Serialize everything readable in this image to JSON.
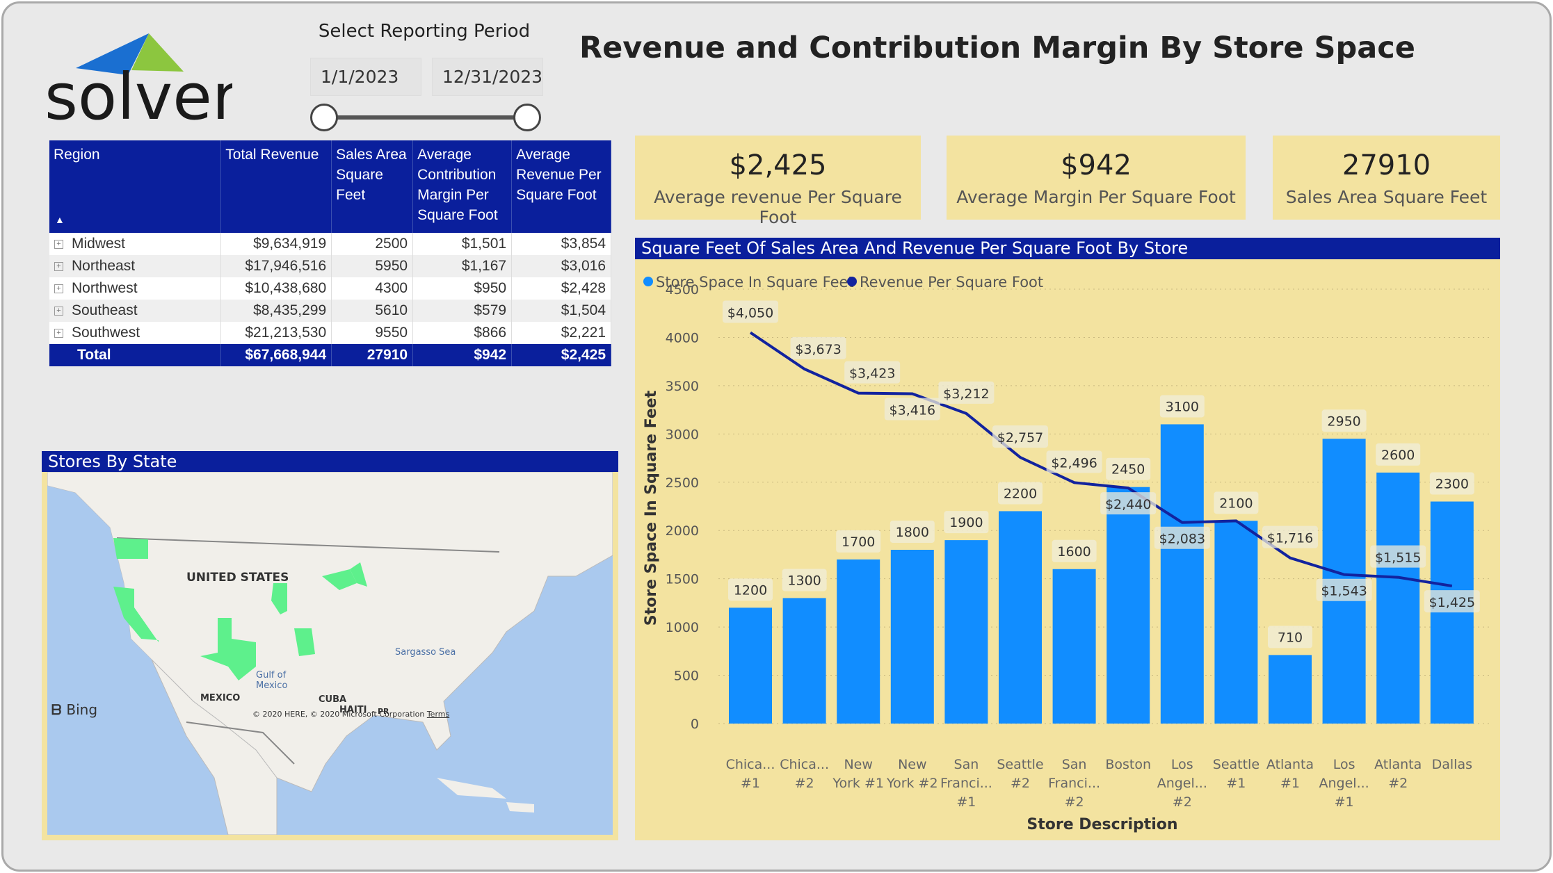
{
  "logo": {
    "text": "solver"
  },
  "title": "Revenue and Contribution Margin By Store Space",
  "period": {
    "label": "Select Reporting Period",
    "start": "1/1/2023",
    "end": "12/31/2023"
  },
  "table": {
    "headers": [
      "Region",
      "Total Revenue",
      "Sales Area Square Feet",
      "Average Contribution Margin Per Square Foot",
      "Average Revenue Per Square Foot"
    ],
    "rows": [
      [
        "Midwest",
        "$9,634,919",
        "2500",
        "$1,501",
        "$3,854"
      ],
      [
        "Northeast",
        "$17,946,516",
        "5950",
        "$1,167",
        "$3,016"
      ],
      [
        "Northwest",
        "$10,438,680",
        "4300",
        "$950",
        "$2,428"
      ],
      [
        "Southeast",
        "$8,435,299",
        "5610",
        "$579",
        "$1,504"
      ],
      [
        "Southwest",
        "$21,213,530",
        "9550",
        "$866",
        "$2,221"
      ]
    ],
    "total": [
      "Total",
      "$67,668,944",
      "27910",
      "$942",
      "$2,425"
    ]
  },
  "kpis": [
    {
      "value": "$2,425",
      "label": "Average revenue Per Square Foot"
    },
    {
      "value": "$942",
      "label": "Average Margin Per Square Foot"
    },
    {
      "value": "27910",
      "label": "Sales Area Square Feet"
    }
  ],
  "map": {
    "title": "Stores By State",
    "labels": {
      "us": "UNITED STATES",
      "mexico": "MEXICO",
      "gulf": "Gulf of Mexico",
      "sargasso": "Sargasso Sea",
      "cuba": "CUBA",
      "haiti": "HAITI",
      "pr": "PR",
      "bing": "Bing",
      "copyright": "© 2020 HERE, © 2020 Microsoft Corporation",
      "terms": "Terms"
    },
    "highlight_color": "#5ef08c"
  },
  "chart_data": {
    "type": "bar+line",
    "title": "Square Feet Of Sales Area And Revenue Per Square Foot By Store",
    "xlabel": "Store Description",
    "ylabel": "Store Space In Square Feet",
    "ylim": [
      0,
      4500
    ],
    "yticks": [
      0,
      500,
      1000,
      1500,
      2000,
      2500,
      3000,
      3500,
      4000,
      4500
    ],
    "grid": true,
    "legend_position": "top-left",
    "categories": [
      [
        "Chica...",
        "#1"
      ],
      [
        "Chica...",
        "#2"
      ],
      [
        "New",
        "York #1"
      ],
      [
        "New",
        "York #2"
      ],
      [
        "San",
        "Franci...",
        "#1"
      ],
      [
        "Seattle",
        "#2"
      ],
      [
        "San",
        "Franci...",
        "#2"
      ],
      [
        "Boston"
      ],
      [
        "Los",
        "Angel...",
        "#2"
      ],
      [
        "Seattle",
        "#1"
      ],
      [
        "Atlanta",
        "#1"
      ],
      [
        "Los",
        "Angel...",
        "#1"
      ],
      [
        "Atlanta",
        "#2"
      ],
      [
        "Dallas"
      ]
    ],
    "series": [
      {
        "name": "Store Space In Square Feet",
        "type": "bar",
        "color": "#118dff",
        "values": [
          1200,
          1300,
          1700,
          1800,
          1900,
          2200,
          1600,
          2450,
          3100,
          2100,
          710,
          2950,
          2600,
          2300
        ],
        "labels": [
          "1200",
          "1300",
          "1700",
          "1800",
          "1900",
          "2200",
          "1600",
          "2450",
          "3100",
          "2100",
          "710",
          "2950",
          "2600",
          "2300"
        ]
      },
      {
        "name": "Revenue Per Square Foot",
        "type": "line",
        "color": "#12239e",
        "values": [
          4050,
          3673,
          3423,
          3416,
          3212,
          2757,
          2496,
          2440,
          2083,
          2100,
          1716,
          1543,
          1515,
          1425
        ],
        "labels": [
          "$4,050",
          "$3,673",
          "$3,423",
          "$3,416",
          "$3,212",
          "$2,757",
          "$2,496",
          "$2,440",
          "$2,083",
          "",
          "$1,716",
          "$1,543",
          "$1,515",
          "$1,425"
        ]
      }
    ]
  }
}
